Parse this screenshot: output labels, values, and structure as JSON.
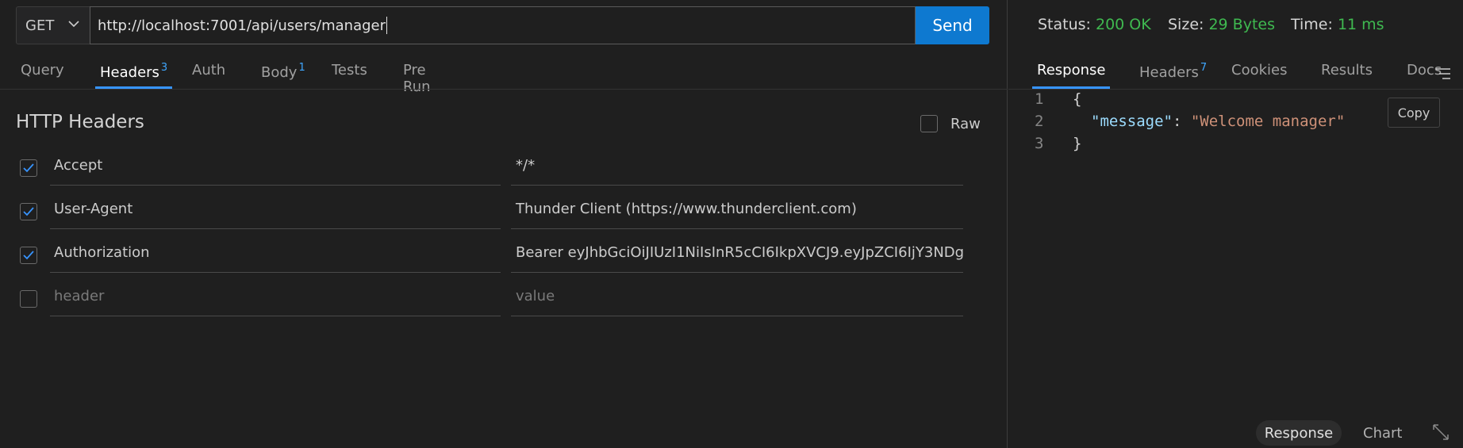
{
  "request": {
    "method": "GET",
    "url": "http://localhost:7001/api/users/manager",
    "send_label": "Send"
  },
  "request_tabs": [
    {
      "label": "Query",
      "badge": ""
    },
    {
      "label": "Headers",
      "badge": "3"
    },
    {
      "label": "Auth",
      "badge": ""
    },
    {
      "label": "Body",
      "badge": "1"
    },
    {
      "label": "Tests",
      "badge": ""
    },
    {
      "label": "Pre Run",
      "badge": ""
    }
  ],
  "headers_section": {
    "title": "HTTP Headers",
    "raw_label": "Raw",
    "rows": [
      {
        "key": "Accept",
        "value": "*/*",
        "checked": true
      },
      {
        "key": "User-Agent",
        "value": "Thunder Client (https://www.thunderclient.com)",
        "checked": true
      },
      {
        "key": "Authorization",
        "value": "Bearer eyJhbGciOiJIUzI1NiIsInR5cCI6IkpXVCJ9.eyJpZCI6IjY3NDgwN",
        "checked": true
      }
    ],
    "new_row": {
      "key_placeholder": "header",
      "value_placeholder": "value"
    }
  },
  "response": {
    "status_label": "Status:",
    "status_value": "200 OK",
    "size_label": "Size:",
    "size_value": "29 Bytes",
    "time_label": "Time:",
    "time_value": "11 ms",
    "tabs": [
      {
        "label": "Response",
        "badge": ""
      },
      {
        "label": "Headers",
        "badge": "7"
      },
      {
        "label": "Cookies",
        "badge": ""
      },
      {
        "label": "Results",
        "badge": ""
      },
      {
        "label": "Docs",
        "badge": ""
      }
    ],
    "body": {
      "line_numbers": [
        "1",
        "2",
        "3"
      ],
      "open_brace": "{",
      "key": "\"message\"",
      "colon": ": ",
      "value": "\"Welcome manager\"",
      "close_brace": "}"
    },
    "copy_label": "Copy",
    "bottom_tabs": {
      "response": "Response",
      "chart": "Chart"
    }
  },
  "colors": {
    "accent": "#3794ff",
    "send_button": "#0e79d0",
    "success": "#3fb950"
  }
}
